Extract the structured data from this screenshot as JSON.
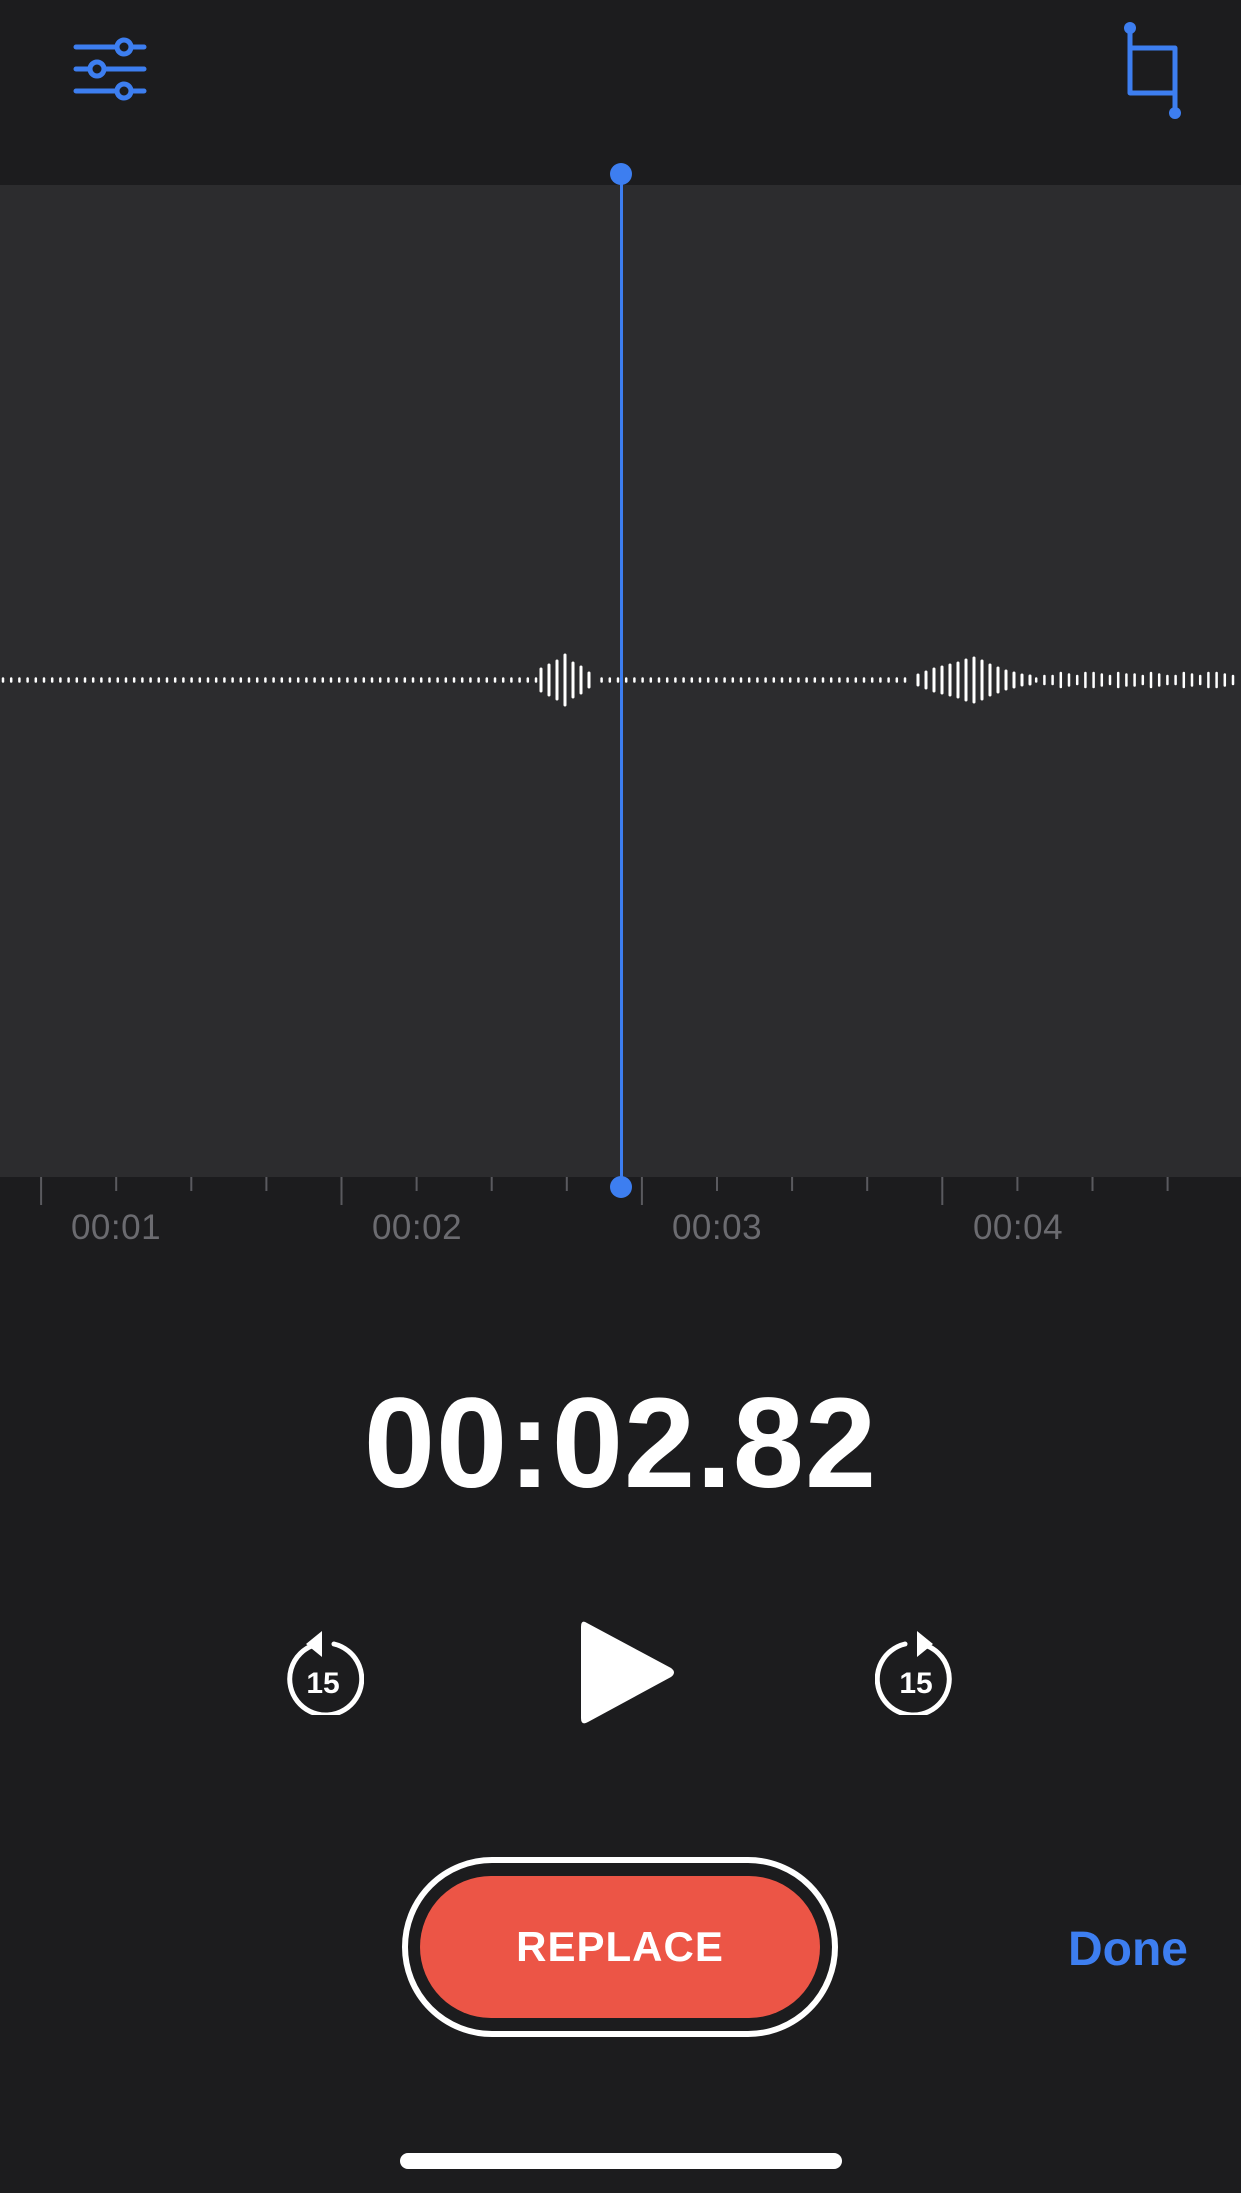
{
  "toolbar": {
    "settings_icon": "sliders-icon",
    "trim_icon": "crop-trim-icon",
    "accent_color": "#3d7ef0"
  },
  "timeline": {
    "tick_labels": [
      "00:01",
      "00:02",
      "00:03",
      "00:04"
    ]
  },
  "playback": {
    "current_time": "00:02.82",
    "skip_back_label": "15",
    "skip_forward_label": "15",
    "play_icon": "play-icon"
  },
  "actions": {
    "replace_label": "REPLACE",
    "done_label": "Done",
    "replace_color": "#ec5546"
  }
}
